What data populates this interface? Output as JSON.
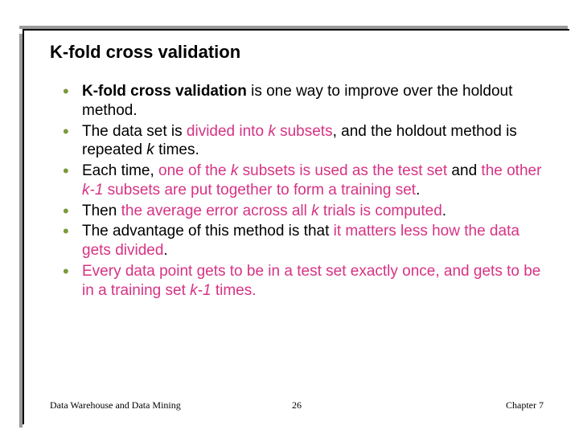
{
  "title": "K-fold cross validation",
  "bullets": [
    {
      "segments": [
        {
          "text": "K-fold cross validation",
          "bold": true
        },
        {
          "text": " is one way to improve over the holdout method."
        }
      ]
    },
    {
      "segments": [
        {
          "text": "The data set is "
        },
        {
          "text": "divided into ",
          "pink": true
        },
        {
          "text": "k",
          "pink": true,
          "ital": true
        },
        {
          "text": " subsets",
          "pink": true
        },
        {
          "text": ", and the holdout method is repeated "
        },
        {
          "text": "k",
          "ital": true
        },
        {
          "text": " times."
        }
      ]
    },
    {
      "segments": [
        {
          "text": "Each time, "
        },
        {
          "text": "one of the ",
          "pink": true
        },
        {
          "text": "k",
          "pink": true,
          "ital": true
        },
        {
          "text": " subsets is used as the test set",
          "pink": true
        },
        {
          "text": " and "
        },
        {
          "text": "the other ",
          "pink": true
        },
        {
          "text": "k-1",
          "pink": true,
          "ital": true
        },
        {
          "text": " subsets are put together to form a training set",
          "pink": true
        },
        {
          "text": "."
        }
      ]
    },
    {
      "segments": [
        {
          "text": "Then "
        },
        {
          "text": "the average error across all ",
          "pink": true
        },
        {
          "text": "k",
          "pink": true,
          "ital": true
        },
        {
          "text": " trials is computed",
          "pink": true
        },
        {
          "text": "."
        }
      ]
    },
    {
      "segments": [
        {
          "text": "The advantage of this method is that "
        },
        {
          "text": "it matters less how the data gets divided",
          "pink": true
        },
        {
          "text": "."
        }
      ]
    },
    {
      "segments": [
        {
          "text": "Every data point gets to be in a test set exactly once, and gets to be in a training set ",
          "pink": true
        },
        {
          "text": "k-1",
          "pink": true,
          "ital": true
        },
        {
          "text": " times.",
          "pink": true
        }
      ]
    }
  ],
  "footer": {
    "left": "Data Warehouse and Data Mining",
    "center": "26",
    "right": "Chapter 7"
  }
}
